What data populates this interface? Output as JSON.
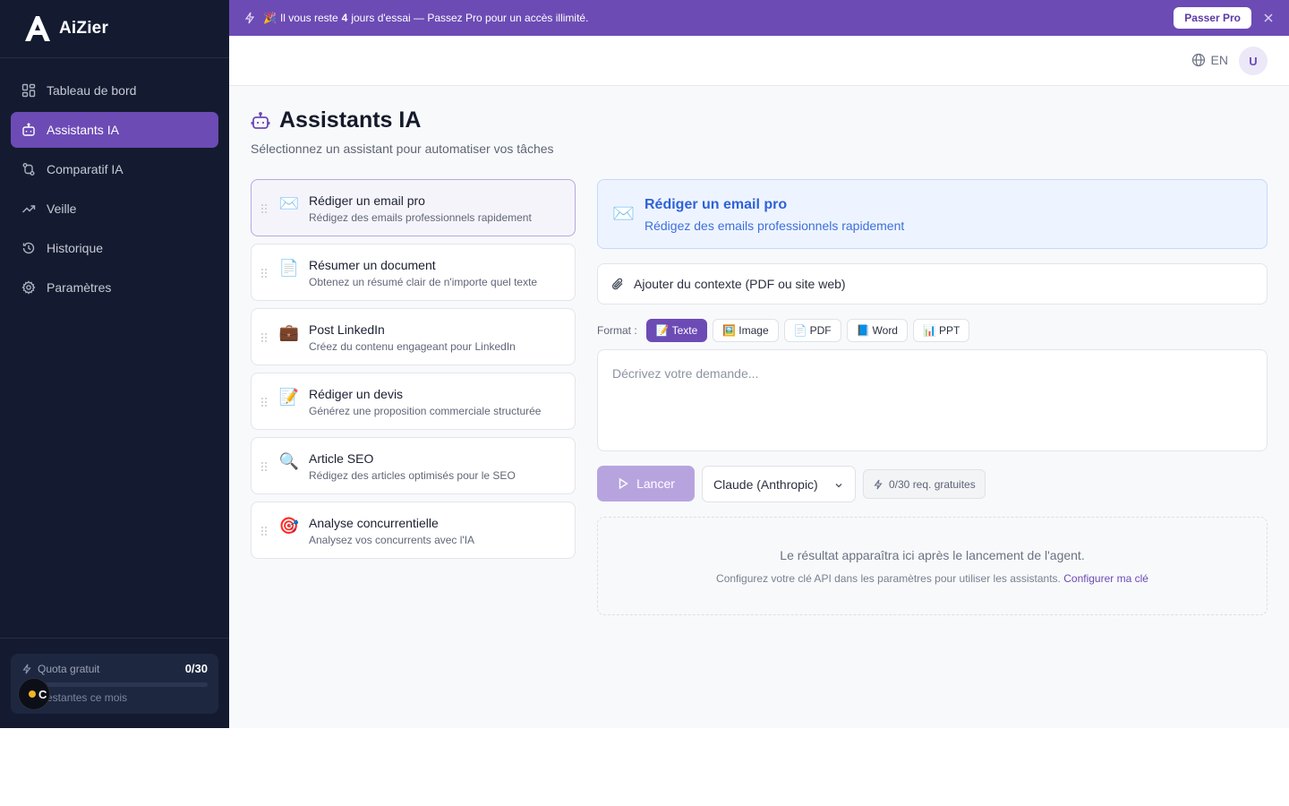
{
  "app": {
    "name": "AiZier"
  },
  "sidebar": {
    "items": [
      {
        "label": "Tableau de bord",
        "icon": "layout-grid-icon",
        "active": false
      },
      {
        "label": "Assistants IA",
        "icon": "bot-icon",
        "active": true
      },
      {
        "label": "Comparatif IA",
        "icon": "git-compare-icon",
        "active": false
      },
      {
        "label": "Veille",
        "icon": "trending-up-icon",
        "active": false
      },
      {
        "label": "Historique",
        "icon": "history-icon",
        "active": false
      },
      {
        "label": "Paramètres",
        "icon": "gear-icon",
        "active": false
      }
    ],
    "quota": {
      "label": "Quota gratuit",
      "count": "0/30",
      "used_fraction": 0,
      "sub": "req. restantes ce mois"
    },
    "floating_badge": {
      "letter": "C",
      "status_color": "#f5b325"
    }
  },
  "banner": {
    "emoji": "🎉",
    "text_before": "Il vous reste",
    "days": "4",
    "text_after": "jours d'essai — Passez Pro pour un accès illimité.",
    "cta": "Passer Pro"
  },
  "topbar": {
    "lang": "EN",
    "avatar": "U"
  },
  "page": {
    "title": "Assistants IA",
    "subtitle": "Sélectionnez un assistant pour automatiser vos tâches"
  },
  "assistants": [
    {
      "emoji": "✉️",
      "title": "Rédiger un email pro",
      "desc": "Rédigez des emails professionnels rapidement"
    },
    {
      "emoji": "📄",
      "title": "Résumer un document",
      "desc": "Obtenez un résumé clair de n'importe quel texte"
    },
    {
      "emoji": "💼",
      "title": "Post LinkedIn",
      "desc": "Créez du contenu engageant pour LinkedIn"
    },
    {
      "emoji": "📝",
      "title": "Rédiger un devis",
      "desc": "Générez une proposition commerciale structurée"
    },
    {
      "emoji": "🔍",
      "title": "Article SEO",
      "desc": "Rédigez des articles optimisés pour le SEO"
    },
    {
      "emoji": "🎯",
      "title": "Analyse concurrentielle",
      "desc": "Analysez vos concurrents avec l'IA"
    }
  ],
  "selected": {
    "emoji": "✉️",
    "title": "Rédiger un email pro",
    "desc": "Rédigez des emails professionnels rapidement"
  },
  "context_button": "Ajouter du contexte (PDF ou site web)",
  "format": {
    "label": "Format :",
    "options": [
      {
        "emoji": "📝",
        "label": "Texte",
        "active": true
      },
      {
        "emoji": "🖼️",
        "label": "Image",
        "active": false
      },
      {
        "emoji": "📄",
        "label": "PDF",
        "active": false
      },
      {
        "emoji": "📘",
        "label": "Word",
        "active": false
      },
      {
        "emoji": "📊",
        "label": "PPT",
        "active": false
      }
    ]
  },
  "prompt": {
    "placeholder": "Décrivez votre demande...",
    "value": ""
  },
  "run": {
    "label": "Lancer",
    "model": "Claude (Anthropic)",
    "requests": "0/30 req. gratuites"
  },
  "result": {
    "main": "Le résultat apparaîtra ici après le lancement de l'agent.",
    "hint": "Configurez votre clé API dans les paramètres pour utiliser les assistants.",
    "link": "Configurer ma clé"
  },
  "colors": {
    "sidebar_bg": "#141b30",
    "accent": "#6c4bb5",
    "selected_blue": "#2e63d8",
    "run_disabled": "#b7a4df"
  }
}
